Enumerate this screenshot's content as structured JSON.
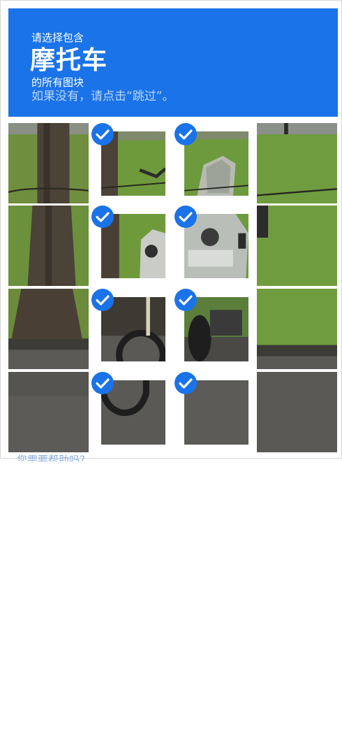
{
  "captcha": {
    "prompt_prefix": "请选择包含",
    "target_object": "摩托车",
    "prompt_suffix": "的所有图块",
    "skip_hint": "如果没有，请点击“跳过”。",
    "accent_color": "#1a73e8",
    "grid": {
      "rows": 4,
      "cols": 4,
      "tiles": [
        {
          "row": 0,
          "col": 0,
          "selected": false,
          "content": "tree-trunk-grass"
        },
        {
          "row": 0,
          "col": 1,
          "selected": true,
          "content": "grass-chain"
        },
        {
          "row": 0,
          "col": 2,
          "selected": true,
          "content": "motorcycle-windshield"
        },
        {
          "row": 0,
          "col": 3,
          "selected": false,
          "content": "grass-post"
        },
        {
          "row": 1,
          "col": 0,
          "selected": false,
          "content": "tree-trunk-grass"
        },
        {
          "row": 1,
          "col": 1,
          "selected": true,
          "content": "motorcycle-fairing"
        },
        {
          "row": 1,
          "col": 2,
          "selected": true,
          "content": "motorcycle-headlight"
        },
        {
          "row": 1,
          "col": 3,
          "selected": false,
          "content": "grass"
        },
        {
          "row": 2,
          "col": 0,
          "selected": false,
          "content": "tree-base-curb"
        },
        {
          "row": 2,
          "col": 1,
          "selected": true,
          "content": "motorcycle-front-wheel"
        },
        {
          "row": 2,
          "col": 2,
          "selected": true,
          "content": "motorcycle-engine"
        },
        {
          "row": 2,
          "col": 3,
          "selected": false,
          "content": "grass-curb"
        },
        {
          "row": 3,
          "col": 0,
          "selected": false,
          "content": "asphalt"
        },
        {
          "row": 3,
          "col": 1,
          "selected": true,
          "content": "motorcycle-tire-asphalt"
        },
        {
          "row": 3,
          "col": 2,
          "selected": true,
          "content": "asphalt"
        },
        {
          "row": 3,
          "col": 3,
          "selected": false,
          "content": "asphalt"
        }
      ]
    },
    "check_icon": "checkmark-circle-icon"
  },
  "page": {
    "below_text": "您需要帮助吗？"
  }
}
